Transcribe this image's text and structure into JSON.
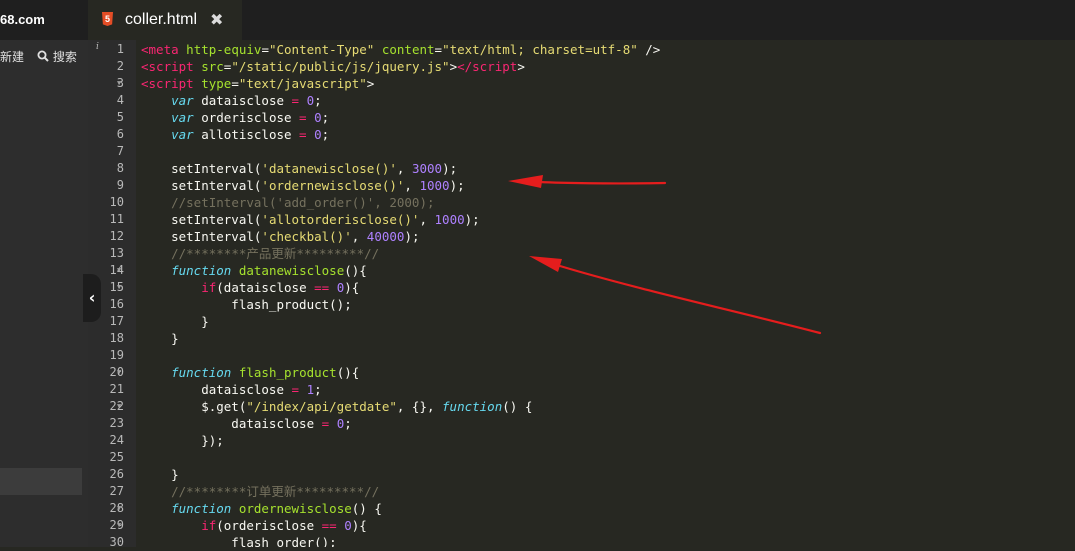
{
  "sidebar": {
    "site": "68.com",
    "new_label": "新建",
    "search_label": "搜索"
  },
  "tab": {
    "filename": "coller.html",
    "file_icon": "5",
    "close_glyph": "✖"
  },
  "gutter": {
    "info_glyph": "i",
    "fold_marker": "▼"
  },
  "collapse_glyph": "‹",
  "arrow_color": "#e51d1d",
  "colors": {
    "tag": "#f92672",
    "attr": "#a6e22e",
    "string": "#e6db74",
    "number": "#ae81ff",
    "keyword": "#66d9ef",
    "comment": "#75715e"
  },
  "code_lines": [
    {
      "n": "1",
      "fold": false,
      "tokens": [
        [
          "t",
          "<meta"
        ],
        [
          "p",
          " "
        ],
        [
          "a",
          "http-equiv"
        ],
        [
          "p",
          "="
        ],
        [
          "s",
          "\"Content-Type\""
        ],
        [
          "p",
          " "
        ],
        [
          "a",
          "content"
        ],
        [
          "p",
          "="
        ],
        [
          "s",
          "\"text/html; charset=utf-8\""
        ],
        [
          "p",
          " />"
        ]
      ]
    },
    {
      "n": "2",
      "fold": false,
      "tokens": [
        [
          "t",
          "<script"
        ],
        [
          "p",
          " "
        ],
        [
          "a",
          "src"
        ],
        [
          "p",
          "="
        ],
        [
          "s",
          "\"/static/public/js/jquery.js\""
        ],
        [
          "p",
          ">"
        ],
        [
          "t",
          "</script"
        ],
        [
          "p",
          ">"
        ]
      ]
    },
    {
      "n": "3",
      "fold": true,
      "tokens": [
        [
          "t",
          "<script"
        ],
        [
          "p",
          " "
        ],
        [
          "a",
          "type"
        ],
        [
          "p",
          "="
        ],
        [
          "s",
          "\"text/javascript\""
        ],
        [
          "p",
          ">"
        ]
      ]
    },
    {
      "n": "4",
      "fold": false,
      "tokens": [
        [
          "p",
          "    "
        ],
        [
          "k",
          "var"
        ],
        [
          "p",
          " dataisclose "
        ],
        [
          "t",
          "="
        ],
        [
          "p",
          " "
        ],
        [
          "n",
          "0"
        ],
        [
          "p",
          ";"
        ]
      ]
    },
    {
      "n": "5",
      "fold": false,
      "tokens": [
        [
          "p",
          "    "
        ],
        [
          "k",
          "var"
        ],
        [
          "p",
          " orderisclose "
        ],
        [
          "t",
          "="
        ],
        [
          "p",
          " "
        ],
        [
          "n",
          "0"
        ],
        [
          "p",
          ";"
        ]
      ]
    },
    {
      "n": "6",
      "fold": false,
      "tokens": [
        [
          "p",
          "    "
        ],
        [
          "k",
          "var"
        ],
        [
          "p",
          " allotisclose "
        ],
        [
          "t",
          "="
        ],
        [
          "p",
          " "
        ],
        [
          "n",
          "0"
        ],
        [
          "p",
          ";"
        ]
      ]
    },
    {
      "n": "7",
      "fold": false,
      "tokens": []
    },
    {
      "n": "8",
      "fold": false,
      "tokens": [
        [
          "p",
          "    setInterval("
        ],
        [
          "s",
          "'datanewisclose()'"
        ],
        [
          "p",
          ", "
        ],
        [
          "n",
          "3000"
        ],
        [
          "p",
          ");"
        ]
      ]
    },
    {
      "n": "9",
      "fold": false,
      "tokens": [
        [
          "p",
          "    setInterval("
        ],
        [
          "s",
          "'ordernewisclose()'"
        ],
        [
          "p",
          ", "
        ],
        [
          "n",
          "1000"
        ],
        [
          "p",
          ");"
        ]
      ]
    },
    {
      "n": "10",
      "fold": false,
      "tokens": [
        [
          "p",
          "    "
        ],
        [
          "c",
          "//setInterval('add_order()', 2000);"
        ]
      ]
    },
    {
      "n": "11",
      "fold": false,
      "tokens": [
        [
          "p",
          "    setInterval("
        ],
        [
          "s",
          "'allotorderisclose()'"
        ],
        [
          "p",
          ", "
        ],
        [
          "n",
          "1000"
        ],
        [
          "p",
          ");"
        ]
      ]
    },
    {
      "n": "12",
      "fold": false,
      "tokens": [
        [
          "p",
          "    setInterval("
        ],
        [
          "s",
          "'checkbal()'"
        ],
        [
          "p",
          ", "
        ],
        [
          "n",
          "40000"
        ],
        [
          "p",
          ");"
        ]
      ]
    },
    {
      "n": "13",
      "fold": false,
      "tokens": [
        [
          "p",
          "    "
        ],
        [
          "c",
          "//********产品更新*********//"
        ]
      ]
    },
    {
      "n": "14",
      "fold": true,
      "tokens": [
        [
          "p",
          "    "
        ],
        [
          "k",
          "function"
        ],
        [
          "p",
          " "
        ],
        [
          "f",
          "datanewisclose"
        ],
        [
          "p",
          "(){"
        ]
      ]
    },
    {
      "n": "15",
      "fold": true,
      "tokens": [
        [
          "p",
          "        "
        ],
        [
          "t",
          "if"
        ],
        [
          "p",
          "(dataisclose "
        ],
        [
          "t",
          "=="
        ],
        [
          "p",
          " "
        ],
        [
          "n",
          "0"
        ],
        [
          "p",
          "){"
        ]
      ]
    },
    {
      "n": "16",
      "fold": false,
      "tokens": [
        [
          "p",
          "            flash_product();"
        ]
      ]
    },
    {
      "n": "17",
      "fold": false,
      "tokens": [
        [
          "p",
          "        }"
        ]
      ]
    },
    {
      "n": "18",
      "fold": false,
      "tokens": [
        [
          "p",
          "    }"
        ]
      ]
    },
    {
      "n": "19",
      "fold": false,
      "tokens": []
    },
    {
      "n": "20",
      "fold": true,
      "tokens": [
        [
          "p",
          "    "
        ],
        [
          "k",
          "function"
        ],
        [
          "p",
          " "
        ],
        [
          "f",
          "flash_product"
        ],
        [
          "p",
          "(){"
        ]
      ]
    },
    {
      "n": "21",
      "fold": false,
      "tokens": [
        [
          "p",
          "        dataisclose "
        ],
        [
          "t",
          "="
        ],
        [
          "p",
          " "
        ],
        [
          "n",
          "1"
        ],
        [
          "p",
          ";"
        ]
      ]
    },
    {
      "n": "22",
      "fold": true,
      "tokens": [
        [
          "p",
          "        $.get("
        ],
        [
          "s",
          "\"/index/api/getdate\""
        ],
        [
          "p",
          ", {}, "
        ],
        [
          "k",
          "function"
        ],
        [
          "p",
          "() {"
        ]
      ]
    },
    {
      "n": "23",
      "fold": false,
      "tokens": [
        [
          "p",
          "            dataisclose "
        ],
        [
          "t",
          "="
        ],
        [
          "p",
          " "
        ],
        [
          "n",
          "0"
        ],
        [
          "p",
          ";"
        ]
      ]
    },
    {
      "n": "24",
      "fold": false,
      "tokens": [
        [
          "p",
          "        });"
        ]
      ]
    },
    {
      "n": "25",
      "fold": false,
      "tokens": []
    },
    {
      "n": "26",
      "fold": false,
      "tokens": [
        [
          "p",
          "    }"
        ]
      ]
    },
    {
      "n": "27",
      "fold": false,
      "tokens": [
        [
          "p",
          "    "
        ],
        [
          "c",
          "//********订单更新*********//"
        ]
      ]
    },
    {
      "n": "28",
      "fold": true,
      "tokens": [
        [
          "p",
          "    "
        ],
        [
          "k",
          "function"
        ],
        [
          "p",
          " "
        ],
        [
          "f",
          "ordernewisclose"
        ],
        [
          "p",
          "() {"
        ]
      ]
    },
    {
      "n": "29",
      "fold": true,
      "tokens": [
        [
          "p",
          "        "
        ],
        [
          "t",
          "if"
        ],
        [
          "p",
          "(orderisclose "
        ],
        [
          "t",
          "=="
        ],
        [
          "p",
          " "
        ],
        [
          "n",
          "0"
        ],
        [
          "p",
          "){"
        ]
      ]
    },
    {
      "n": "30",
      "fold": false,
      "tokens": [
        [
          "p",
          "            flash_order();"
        ]
      ]
    }
  ]
}
